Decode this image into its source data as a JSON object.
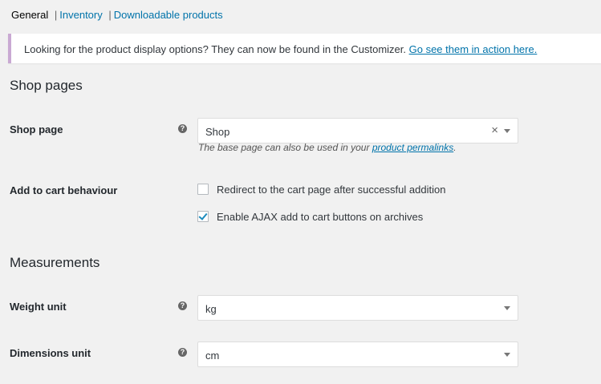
{
  "tabs": {
    "general": "General",
    "separator": "|",
    "inventory": "Inventory",
    "downloadable": "Downloadable products"
  },
  "notice": {
    "text": "Looking for the product display options? They can now be found in the Customizer.",
    "link": "Go see them in action here."
  },
  "shop_pages": {
    "heading": "Shop pages",
    "shop_page": {
      "label": "Shop page",
      "help": "?",
      "value": "Shop",
      "clear": "×",
      "desc_prefix": "The base page can also be used in your",
      "desc_link": "product permalinks",
      "desc_suffix": "."
    },
    "add_to_cart": {
      "label": "Add to cart behaviour",
      "redirect": {
        "label": "Redirect to the cart page after successful addition",
        "checked": false
      },
      "ajax": {
        "label": "Enable AJAX add to cart buttons on archives",
        "checked": true
      }
    }
  },
  "measurements": {
    "heading": "Measurements",
    "weight": {
      "label": "Weight unit",
      "help": "?",
      "value": "kg"
    },
    "dimensions": {
      "label": "Dimensions unit",
      "help": "?",
      "value": "cm"
    }
  },
  "colors": {
    "link": "#0073aa",
    "notice_border": "#c9a9d3",
    "checkmark": "#1e8cbe"
  }
}
